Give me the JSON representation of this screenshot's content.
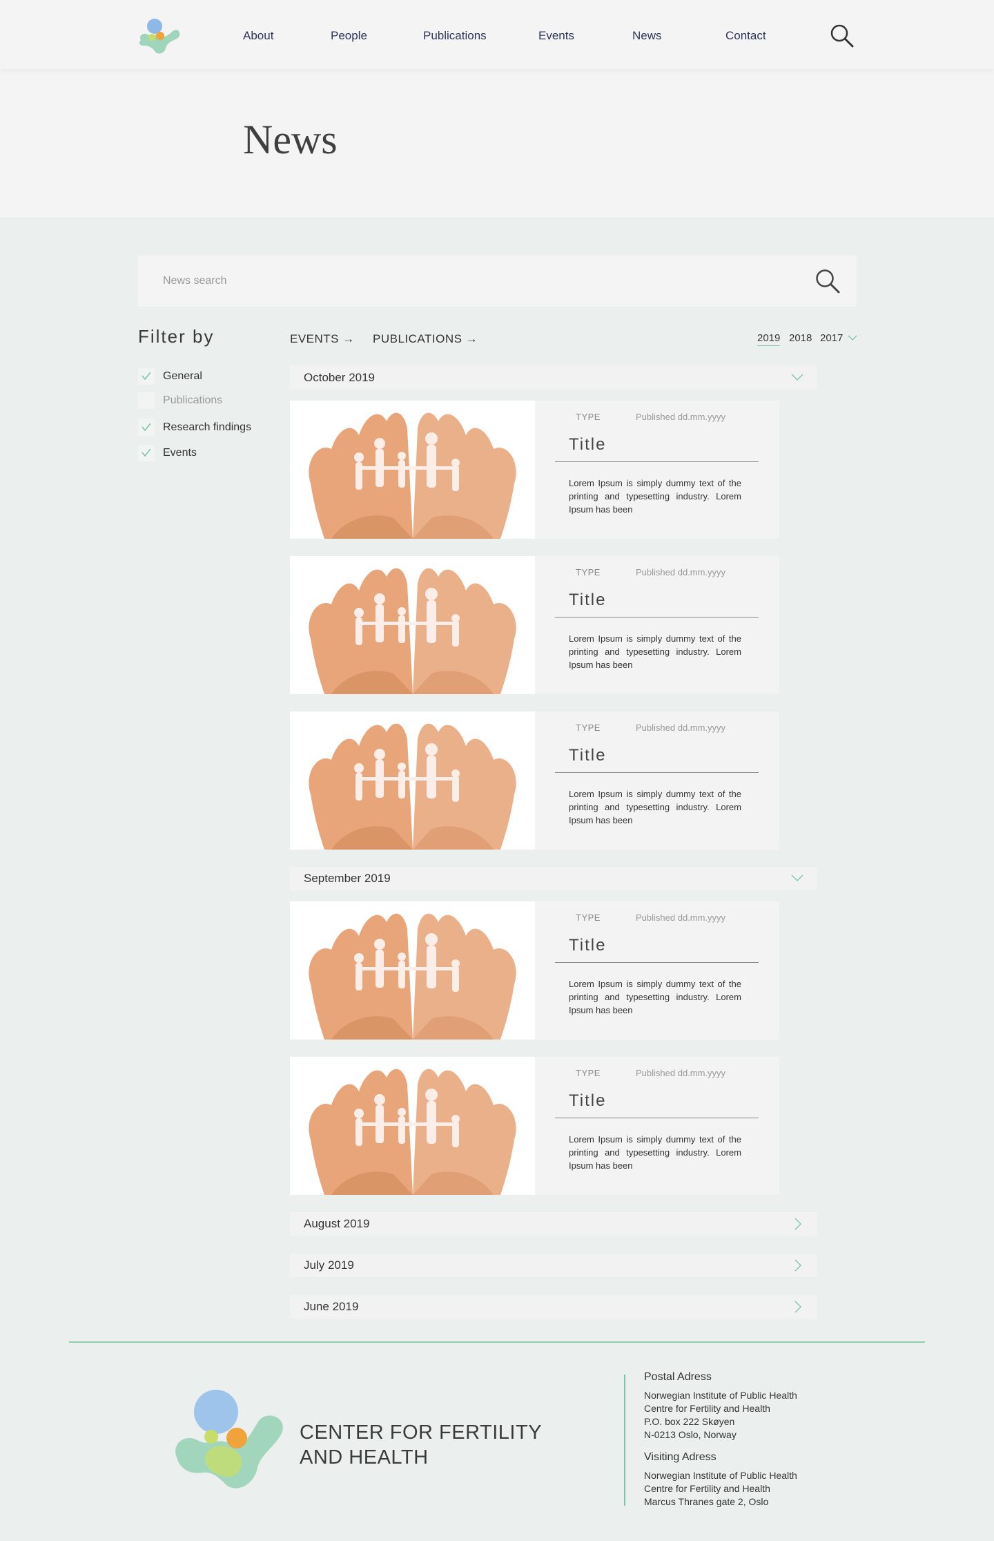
{
  "nav": {
    "items": [
      "About",
      "People",
      "Publications",
      "Events",
      "News",
      "Contact"
    ]
  },
  "hero": {
    "title": "News"
  },
  "search": {
    "placeholder": "News search"
  },
  "filter": {
    "title": "Filter by",
    "items": [
      {
        "label": "General",
        "checked": true
      },
      {
        "label": "Publications",
        "checked": false
      },
      {
        "label": "Research findings",
        "checked": true
      },
      {
        "label": "Events",
        "checked": true
      }
    ]
  },
  "links": {
    "events": "EVENTS",
    "publications": "PUBLICATIONS",
    "arrow": "→"
  },
  "years": {
    "items": [
      "2019",
      "2018",
      "2017"
    ],
    "active": "2019"
  },
  "months": [
    {
      "label": "October 2019",
      "expanded": true
    },
    {
      "label": "September 2019",
      "expanded": true
    },
    {
      "label": "August 2019",
      "expanded": false
    },
    {
      "label": "July 2019",
      "expanded": false
    },
    {
      "label": "June 2019",
      "expanded": false
    }
  ],
  "cards": [
    {
      "type": "TYPE",
      "date": "Published dd.mm.yyyy",
      "title": "Title",
      "excerpt": "Lorem Ipsum is simply dummy text of the printing and typesetting industry. Lorem Ipsum has been"
    },
    {
      "type": "TYPE",
      "date": "Published dd.mm.yyyy",
      "title": "Title",
      "excerpt": "Lorem Ipsum is simply dummy text of the printing and typesetting industry. Lorem Ipsum has been"
    },
    {
      "type": "TYPE",
      "date": "Published dd.mm.yyyy",
      "title": "Title",
      "excerpt": "Lorem Ipsum is simply dummy text of the printing and typesetting industry. Lorem Ipsum has been"
    },
    {
      "type": "TYPE",
      "date": "Published dd.mm.yyyy",
      "title": "Title",
      "excerpt": "Lorem Ipsum is simply dummy text of the printing and typesetting industry. Lorem Ipsum has been"
    },
    {
      "type": "TYPE",
      "date": "Published dd.mm.yyyy",
      "title": "Title",
      "excerpt": "Lorem Ipsum is simply dummy text of the printing and typesetting industry. Lorem Ipsum has been"
    }
  ],
  "footer": {
    "name_line1": "CENTER FOR FERTILITY",
    "name_line2": "AND HEALTH",
    "postal": {
      "heading": "Postal Adress",
      "lines": [
        "Norwegian Institute of Public Health",
        "Centre for Fertility and Health",
        "P.O. box 222 Skøyen",
        "N-0213 Oslo, Norway"
      ]
    },
    "visiting": {
      "heading": "Visiting Adress",
      "lines": [
        "Norwegian Institute of Public Health",
        "Centre for Fertility and Health",
        "Marcus Thranes gate 2, Oslo"
      ]
    }
  },
  "colors": {
    "accent": "#7cc4a2",
    "nav_text": "#2e3556",
    "page_bg": "#ebf0ee",
    "header_bg": "#f4f4f4"
  }
}
